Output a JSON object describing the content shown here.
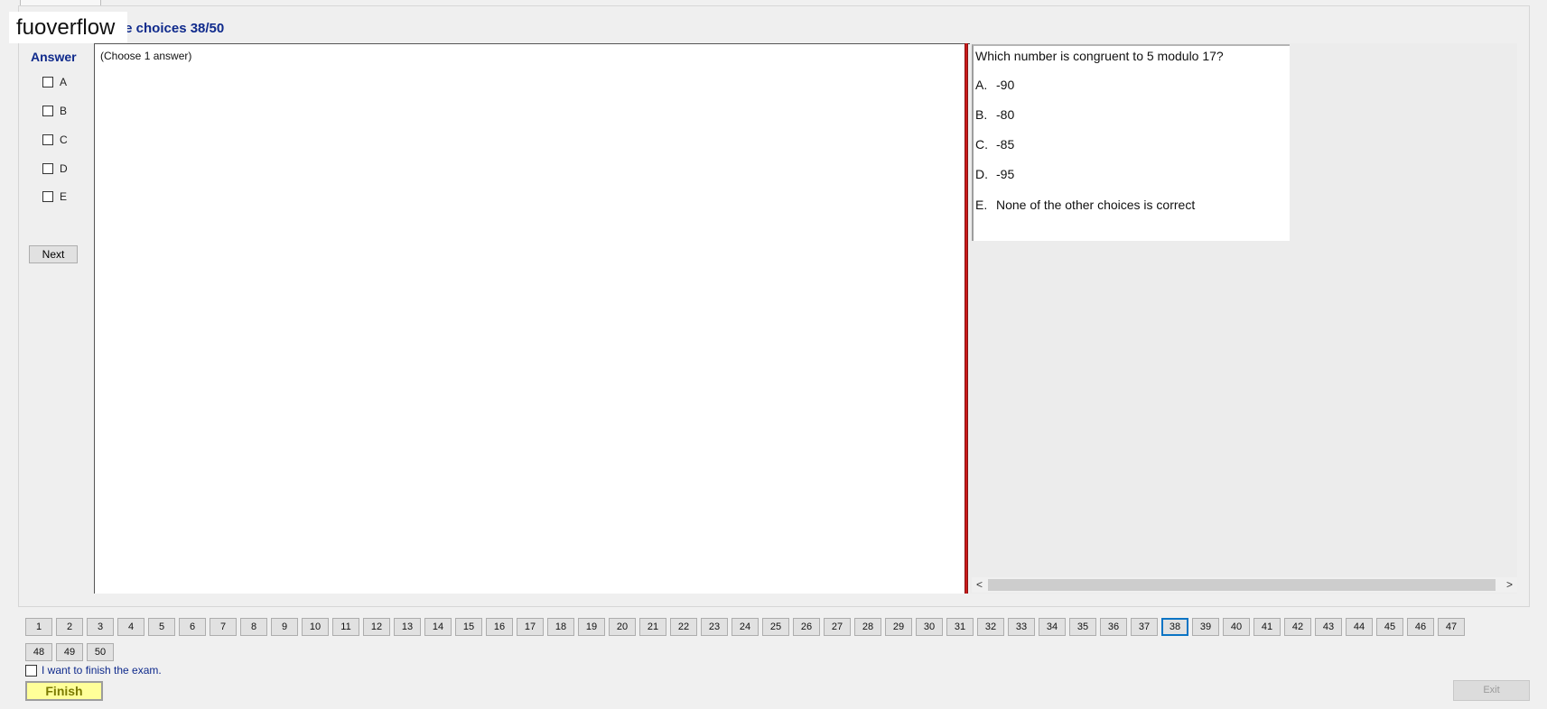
{
  "watermark": "fuoverflow",
  "section_title": "le choices 38/50",
  "answer_label": "Answer",
  "choices": [
    "A",
    "B",
    "C",
    "D",
    "E"
  ],
  "next_label": "Next",
  "answer_hint": "(Choose 1 answer)",
  "question": {
    "text": "Which number is congruent to 5 modulo 17?",
    "options": [
      {
        "letter": "A.",
        "text": "-90"
      },
      {
        "letter": "B.",
        "text": "-80"
      },
      {
        "letter": "C.",
        "text": "-85"
      },
      {
        "letter": "D.",
        "text": "-95"
      },
      {
        "letter": "E.",
        "text": "None of the other choices is correct"
      }
    ]
  },
  "scroll": {
    "left": "<",
    "right": ">"
  },
  "nav": {
    "numbers": [
      "1",
      "2",
      "3",
      "4",
      "5",
      "6",
      "7",
      "8",
      "9",
      "10",
      "11",
      "12",
      "13",
      "14",
      "15",
      "16",
      "17",
      "18",
      "19",
      "20",
      "21",
      "22",
      "23",
      "24",
      "25",
      "26",
      "27",
      "28",
      "29",
      "30",
      "31",
      "32",
      "33",
      "34",
      "35",
      "36",
      "37",
      "38",
      "39",
      "40",
      "41",
      "42",
      "43",
      "44",
      "45",
      "46",
      "47",
      "48",
      "49",
      "50"
    ],
    "current": "38"
  },
  "finish_check_label": "I want to finish the exam.",
  "finish_label": "Finish",
  "exit_label": "Exit",
  "colors": {
    "accent_text": "#0f2a8c",
    "splitter": "#c91b1b",
    "finish_bg": "#ffff99",
    "active_border": "#0a74c4"
  }
}
